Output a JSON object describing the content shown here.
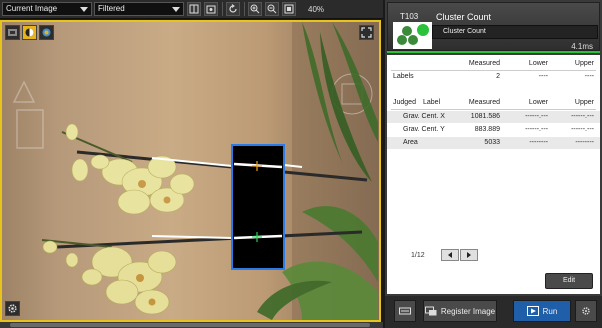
{
  "toolbar": {
    "image_select": "Current Image",
    "mode_select": "Filtered",
    "zoom": "40%",
    "icons": [
      "layout-icon",
      "image-info-icon",
      "refresh-icon",
      "zoom-in-icon",
      "zoom-out-icon",
      "fit-icon"
    ]
  },
  "pane": {
    "icons": [
      "camera-icon",
      "color-icon",
      "circle-mode-icon",
      "expand-icon",
      "settings-icon"
    ]
  },
  "tool": {
    "id": "T103",
    "title": "Cluster Count",
    "subtitle": "Cluster Count",
    "time": "4.1ms",
    "status_color": "#29c23a"
  },
  "results": {
    "labels_table": {
      "headers": [
        "Measured",
        "Lower",
        "Upper"
      ],
      "rows": [
        {
          "name": "Labels",
          "measured": "2",
          "lower": "----",
          "upper": "----"
        }
      ]
    },
    "judged_table": {
      "headers": [
        "Judged",
        "Label",
        "Measured",
        "Lower",
        "Upper"
      ],
      "rows": [
        {
          "name": "Grav. Cent. X",
          "measured": "1081.586",
          "lower": "------.---",
          "upper": "------.---"
        },
        {
          "name": "Grav. Cent. Y",
          "measured": "883.889",
          "lower": "------.---",
          "upper": "------.---"
        },
        {
          "name": "Area",
          "measured": "5033",
          "lower": "--------",
          "upper": "--------"
        }
      ]
    },
    "pager": "1/12",
    "edit_label": "Edit"
  },
  "bottom": {
    "register_label": "Register Image",
    "run_label": "Run"
  },
  "colors": {
    "selection_border": "#e8c41a",
    "roi_border": "#2a7be8",
    "accent_blue": "#1f5ea8"
  }
}
